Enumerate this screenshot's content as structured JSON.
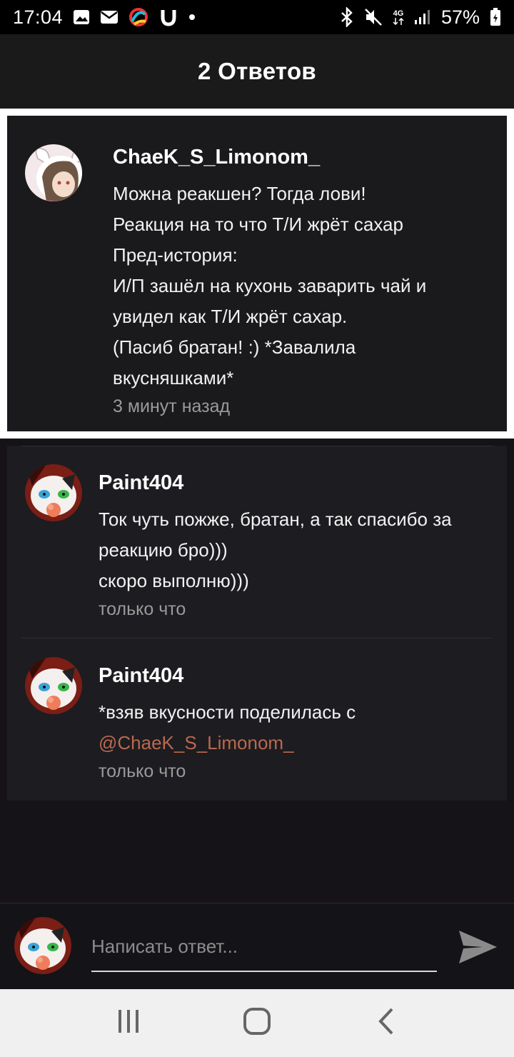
{
  "status_bar": {
    "time": "17:04",
    "battery": "57%",
    "network": "4G",
    "icons": [
      "image-icon",
      "mail-icon",
      "app-icon",
      "app-icon",
      "dot-icon",
      "bluetooth-icon",
      "mute-icon",
      "network-icon",
      "signal-icon",
      "battery-icon"
    ]
  },
  "header": {
    "title": "2 Ответов"
  },
  "original_comment": {
    "author": "ChaeK_S_Limonom_",
    "text": "Можна реакшен? Тогда лови!\nРеакция на то что Т/И жрёт сахар\nПред-история:\nИ/П зашёл на кухонь заварить чай и\nувидел как Т/И жрёт сахар.\n(Пасиб братан! :) *Завалила\nвкусняшками*",
    "time": "3 минут назад"
  },
  "replies": [
    {
      "author": "Paint404",
      "text": "Ток чуть пожже, братан, а так спасибо за\nреакцию бро)))\nскоро выполню)))",
      "time": "только что"
    },
    {
      "author": "Paint404",
      "text": "*взяв вкусности поделилась с",
      "mention": "@ChaeK_S_Limonom_",
      "time": "только что"
    }
  ],
  "composer": {
    "placeholder": "Написать ответ..."
  },
  "colors": {
    "mention": "#b8694f",
    "background": "#151318",
    "card": "#1a191c"
  }
}
